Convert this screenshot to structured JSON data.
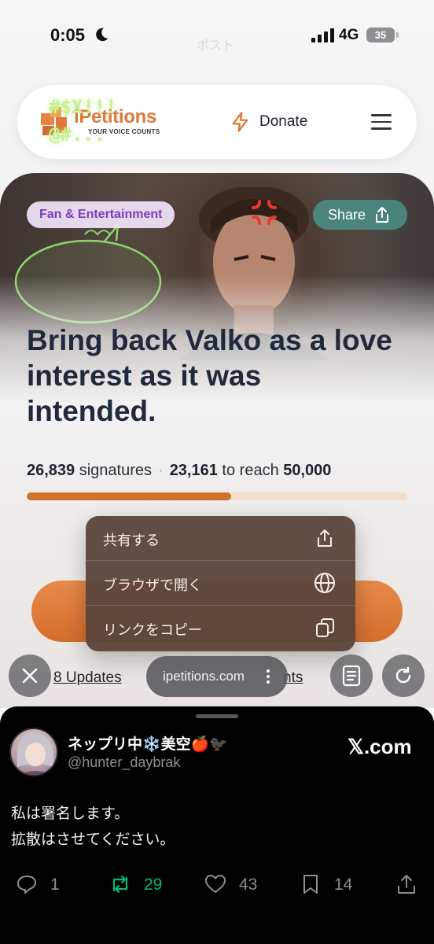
{
  "status_bar": {
    "time": "0:05",
    "network": "4G",
    "battery": "35",
    "ghost_text": "ポスト"
  },
  "nav": {
    "brand": "iPetitions",
    "tagline": "YOUR VOICE COUNTS",
    "donate_label": "Donate"
  },
  "hero": {
    "category": "Fan & Entertainment",
    "share_label": "Share",
    "bubble_line1": "#$X!!!",
    "bubble_line2": "@#...",
    "headline": "Bring back Valko as a love interest as it was intended."
  },
  "stats": {
    "signatures": "26,839",
    "signatures_label": "signatures",
    "remaining": "23,161",
    "to_reach_label": "to reach",
    "goal": "50,000",
    "progress_fraction": 0.537
  },
  "page_links": {
    "updates": "8 Updates",
    "comments_partial": "nts"
  },
  "context_menu": {
    "items": [
      {
        "label": "共有する",
        "icon": "share-icon"
      },
      {
        "label": "ブラウザで開く",
        "icon": "globe-icon"
      },
      {
        "label": "リンクをコピー",
        "icon": "copy-icon"
      }
    ]
  },
  "browser_bar": {
    "url": "ipetitions.com"
  },
  "tweet": {
    "display_name": "ネップリ中❄️美空🍎🐦‍⬛",
    "handle": "@hunter_daybrak",
    "source": "𝕏.com",
    "text_line1": "私は署名します。",
    "text_line2": "拡散はさせてください。",
    "replies": "1",
    "retweets": "29",
    "likes": "43",
    "bookmarks": "14"
  },
  "colors": {
    "brand_orange": "#e0783a",
    "progress": "#d36f2e",
    "category_purple": "#7c3fb8",
    "retweet_green": "#00ba7c"
  }
}
